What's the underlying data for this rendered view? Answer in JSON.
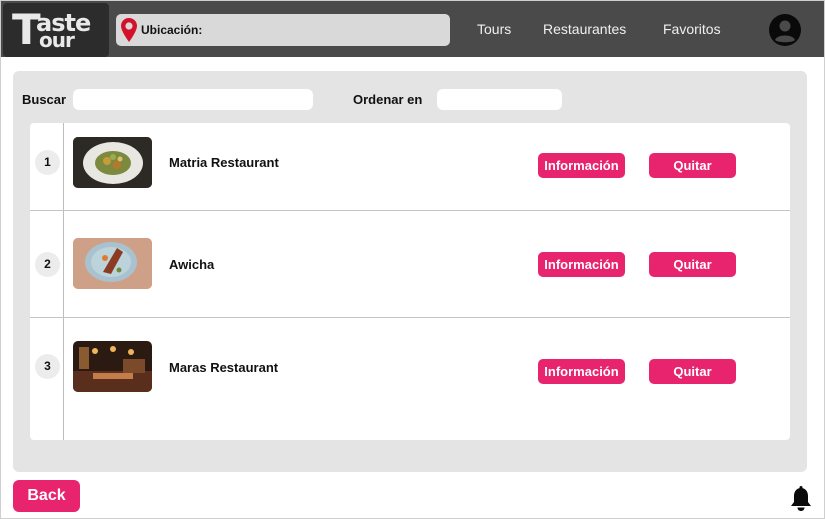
{
  "brand": {
    "line1": "aste",
    "big_letter": "T",
    "line2": "our"
  },
  "header": {
    "location_label": "Ubicación:",
    "nav": [
      "Tours",
      "Restaurantes",
      "Favoritos"
    ]
  },
  "filters": {
    "search_label": "Buscar",
    "search_value": "",
    "sort_label": "Ordenar en",
    "sort_value": ""
  },
  "restaurants": [
    {
      "rank": "1",
      "name": "Matria Restaurant",
      "image": "dish-photo"
    },
    {
      "rank": "2",
      "name": "Awicha",
      "image": "plated-dish-photo"
    },
    {
      "rank": "3",
      "name": "Maras Restaurant",
      "image": "dining-room-photo"
    }
  ],
  "row_actions": {
    "info_label": "Información",
    "remove_label": "Quitar"
  },
  "footer": {
    "back_label": "Back"
  },
  "colors": {
    "topbar": "#4a4a4a",
    "accent": "#e8246f",
    "panel": "#e4e4e4",
    "pin": "#d3112c"
  },
  "icons": {
    "location": "map-pin-icon",
    "profile": "user-avatar-icon",
    "notifications": "bell-icon"
  }
}
